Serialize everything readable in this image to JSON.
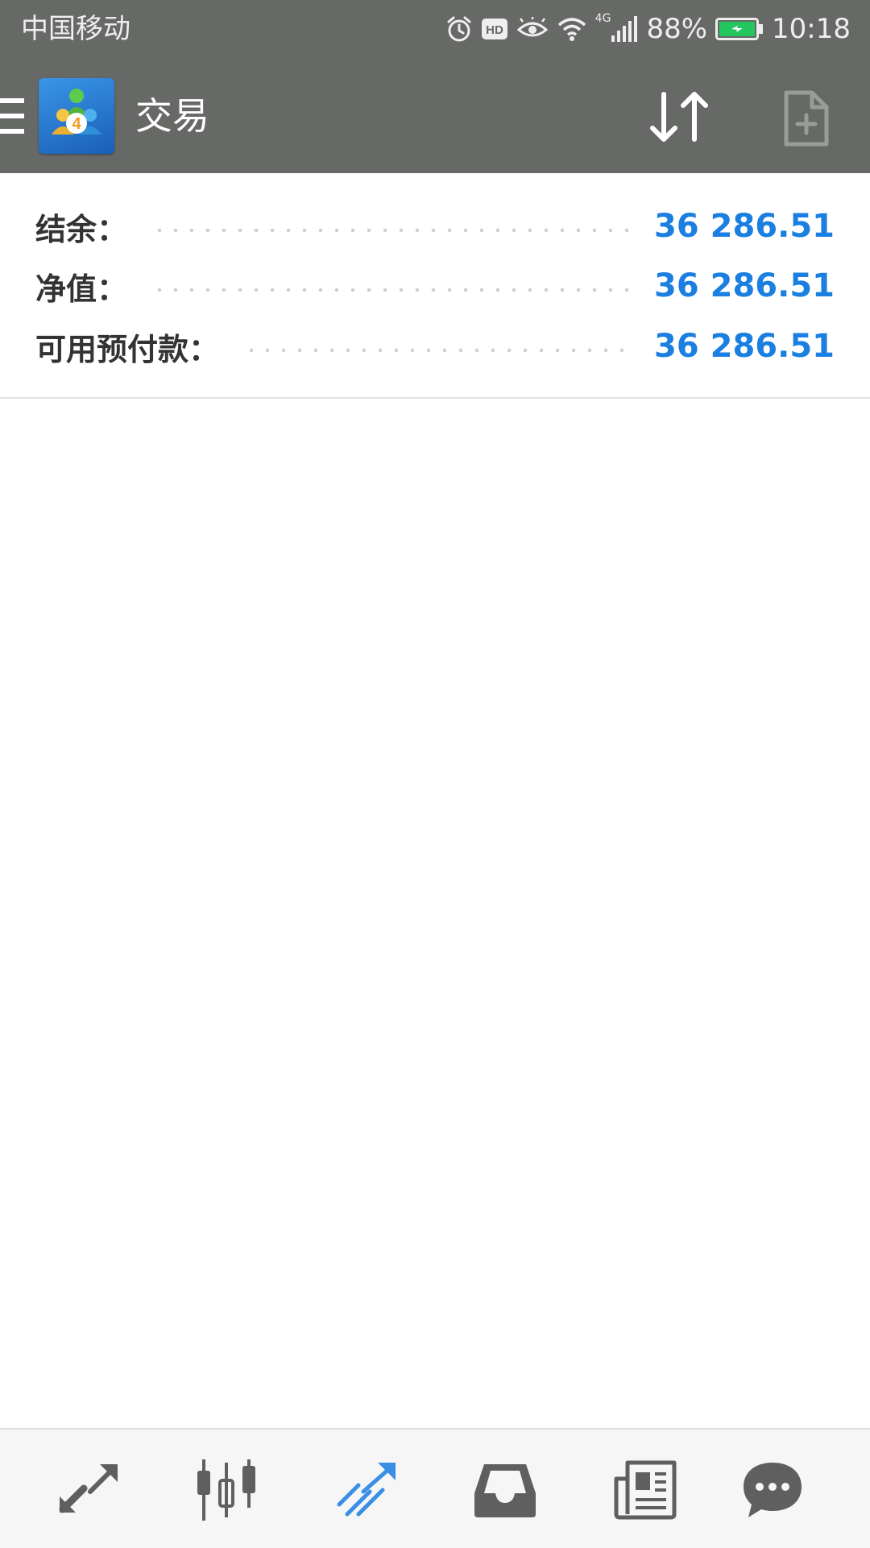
{
  "status_bar": {
    "carrier": "中国移动",
    "network_type": "4G",
    "battery_percent": "88%",
    "time": "10:18",
    "icons": [
      "alarm-icon",
      "hd-icon",
      "eye-icon",
      "wifi-icon",
      "signal-icon",
      "battery-icon"
    ]
  },
  "toolbar": {
    "title": "交易",
    "icons": [
      "menu-icon",
      "app-logo",
      "sort-icon",
      "new-order-icon"
    ]
  },
  "summary": {
    "rows": [
      {
        "label": "结余：",
        "value": "36 286.51"
      },
      {
        "label": "净值：",
        "value": "36 286.51"
      },
      {
        "label": "可用预付款：",
        "value": "36 286.51"
      }
    ]
  },
  "bottom_nav": {
    "items": [
      "quotes-icon",
      "chart-icon",
      "trade-icon",
      "history-icon",
      "news-icon",
      "chat-icon"
    ],
    "active": "trade-icon"
  },
  "colors": {
    "bar_bg": "#666965",
    "value_blue": "#1a7fe0",
    "nav_active": "#3b8ee6",
    "nav_inactive": "#5f5f5f"
  }
}
